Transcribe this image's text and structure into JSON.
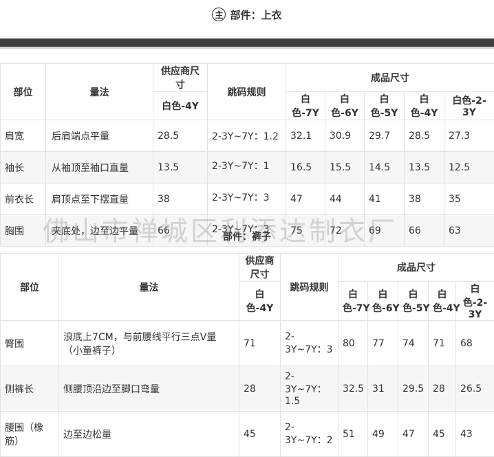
{
  "part1": {
    "badge": "主",
    "title": "部件：上衣"
  },
  "part2": {
    "title": "部件：裤子"
  },
  "watermark": "佛山市禅城区利添达制衣厂",
  "table1": {
    "headers": {
      "position": "部位",
      "method": "量法",
      "supplier_size": "供应商尺寸",
      "supplier_sub": "白色-4Y",
      "grading_rule": "跳码规则",
      "finished_size": "成品尺寸",
      "sizes": [
        "白色-7Y",
        "白色-6Y",
        "白色-5Y",
        "白色-4Y",
        "白色-2-3Y"
      ]
    },
    "rows": [
      {
        "position": "肩宽",
        "method": "后肩端点平量",
        "supplier": "28.5",
        "rule": "2-3Y~7Y：1.2",
        "values": [
          "32.1",
          "30.9",
          "29.7",
          "28.5",
          "27.3"
        ]
      },
      {
        "position": "袖长",
        "method": "从袖顶至袖口直量",
        "supplier": "13.5",
        "rule": "2-3Y~7Y：1",
        "values": [
          "16.5",
          "15.5",
          "14.5",
          "13.5",
          "12.5"
        ]
      },
      {
        "position": "前衣长",
        "method": "肩顶点至下摆直量",
        "supplier": "38",
        "rule": "2-3Y~7Y：3",
        "values": [
          "47",
          "44",
          "41",
          "38",
          "35"
        ]
      },
      {
        "position": "胸围",
        "method": "夹底处，边至边平量",
        "supplier": "66",
        "rule": "2-3Y~7Y：3",
        "values": [
          "75",
          "72",
          "69",
          "66",
          "63"
        ]
      }
    ]
  },
  "table2": {
    "headers": {
      "position": "部位",
      "method": "量法",
      "supplier_size": "供应商尺寸",
      "supplier_sub": "白色-4Y",
      "grading_rule": "跳码规则",
      "finished_size": "成品尺寸",
      "sizes": [
        "白色-7Y",
        "白色-6Y",
        "白色-5Y",
        "白色-4Y",
        "白色-2-3Y"
      ]
    },
    "rows": [
      {
        "position": "臀围",
        "method": "浪底上7CM，与前腰线平行三点V量（小童裤子）",
        "supplier": "71",
        "rule": "2-3Y~7Y：3",
        "values": [
          "80",
          "77",
          "74",
          "71",
          "68"
        ]
      },
      {
        "position": "侧裤长",
        "method": "侧腰顶沿边至脚口弯量",
        "supplier": "28",
        "rule": "2-3Y~7Y：1.5",
        "values": [
          "32.5",
          "31",
          "29.5",
          "28",
          "26.5"
        ]
      },
      {
        "position": "腰围（橡筋）",
        "method": "边至边松量",
        "supplier": "45",
        "rule": "2-3Y~7Y：2",
        "values": [
          "51",
          "49",
          "47",
          "45",
          "43"
        ]
      }
    ]
  }
}
